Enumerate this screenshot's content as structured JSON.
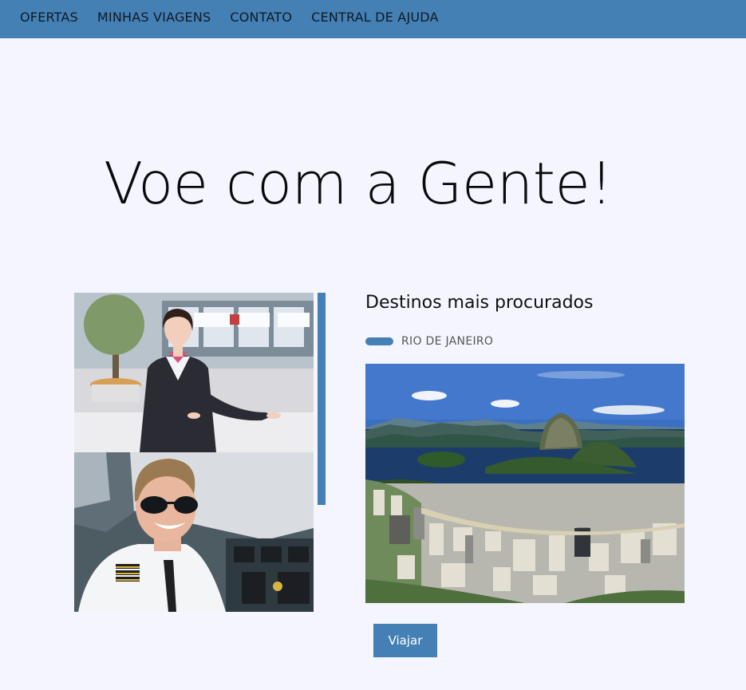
{
  "nav": {
    "items": [
      {
        "label": "OFERTAS"
      },
      {
        "label": "MINHAS VIAGENS"
      },
      {
        "label": "CONTATO"
      },
      {
        "label": "CENTRAL DE AJUDA"
      }
    ]
  },
  "hero": {
    "title": "Voe com a Gente!"
  },
  "destinations": {
    "title": "Destinos mais procurados",
    "current": "RIO DE JANEIRO",
    "button_label": "Viajar"
  },
  "colors": {
    "accent": "#4580b4",
    "background": "#f4f5fe"
  }
}
